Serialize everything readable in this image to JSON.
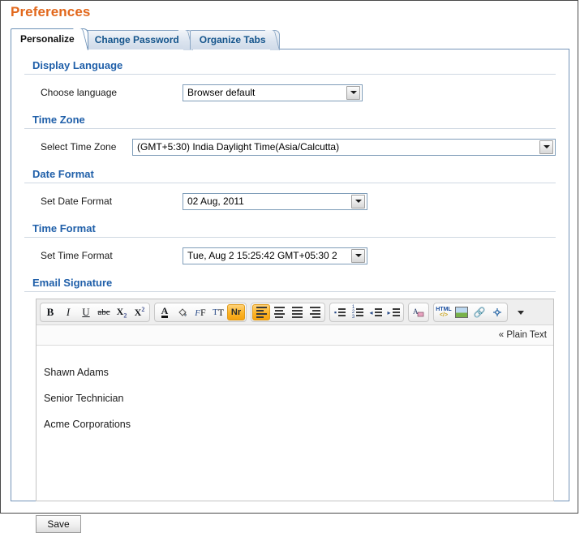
{
  "page": {
    "title": "Preferences"
  },
  "tabs": [
    {
      "label": "Personalize",
      "active": true
    },
    {
      "label": "Change Password",
      "active": false
    },
    {
      "label": "Organize Tabs",
      "active": false
    }
  ],
  "sections": {
    "display_language": {
      "heading": "Display Language",
      "field_label": "Choose language",
      "value": "Browser default"
    },
    "time_zone": {
      "heading": "Time Zone",
      "field_label": "Select Time Zone",
      "value": "(GMT+5:30) India Daylight Time(Asia/Calcutta)"
    },
    "date_format": {
      "heading": "Date Format",
      "field_label": "Set Date Format",
      "value": "02 Aug, 2011"
    },
    "time_format": {
      "heading": "Time Format",
      "field_label": "Set Time Format",
      "value": "Tue, Aug 2 15:25:42 GMT+05:30 2"
    },
    "email_signature": {
      "heading": "Email Signature",
      "plain_text_link": "« Plain Text",
      "signature_lines": [
        "Shawn Adams",
        "Senior Technician",
        "Acme Corporations"
      ]
    }
  },
  "toolbar": {
    "groups": [
      {
        "name": "text-style",
        "buttons": [
          {
            "name": "bold-icon",
            "glyph": "B",
            "active": false
          },
          {
            "name": "italic-icon",
            "glyph": "I",
            "active": false
          },
          {
            "name": "underline-icon",
            "glyph": "U",
            "active": false
          },
          {
            "name": "strikethrough-icon",
            "glyph": "abc",
            "active": false
          },
          {
            "name": "subscript-icon",
            "glyph": "X2",
            "active": false
          },
          {
            "name": "superscript-icon",
            "glyph": "X2",
            "active": false
          }
        ]
      },
      {
        "name": "font-style",
        "buttons": [
          {
            "name": "font-color-icon",
            "glyph": "A",
            "active": false
          },
          {
            "name": "background-color-icon",
            "glyph": "paint-bucket",
            "active": false
          },
          {
            "name": "font-family-icon",
            "glyph": "F",
            "active": false
          },
          {
            "name": "font-size-icon",
            "glyph": "T",
            "active": false
          },
          {
            "name": "normal-format-icon",
            "glyph": "Nr",
            "active": true
          }
        ]
      },
      {
        "name": "alignment",
        "buttons": [
          {
            "name": "align-left-icon",
            "glyph": "align-left",
            "active": true
          },
          {
            "name": "align-center-icon",
            "glyph": "align-center",
            "active": false
          },
          {
            "name": "align-justify-icon",
            "glyph": "align-justify",
            "active": false
          },
          {
            "name": "align-right-icon",
            "glyph": "align-right",
            "active": false
          }
        ]
      },
      {
        "name": "lists",
        "buttons": [
          {
            "name": "bullet-list-icon",
            "glyph": "bullets",
            "active": false
          },
          {
            "name": "numbered-list-icon",
            "glyph": "numbers",
            "active": false
          },
          {
            "name": "outdent-icon",
            "glyph": "outdent",
            "active": false
          },
          {
            "name": "indent-icon",
            "glyph": "indent",
            "active": false
          }
        ]
      },
      {
        "name": "clear-format",
        "buttons": [
          {
            "name": "clear-formatting-icon",
            "glyph": "A-eraser",
            "active": false
          }
        ]
      },
      {
        "name": "insert",
        "buttons": [
          {
            "name": "html-source-icon",
            "glyph": "HTML",
            "active": false
          },
          {
            "name": "insert-image-icon",
            "glyph": "image",
            "active": false
          },
          {
            "name": "insert-link-icon",
            "glyph": "link",
            "active": false
          },
          {
            "name": "unlink-icon",
            "glyph": "unlink",
            "active": false
          }
        ]
      }
    ],
    "overflow": "more-options-icon"
  },
  "actions": {
    "save_label": "Save"
  }
}
